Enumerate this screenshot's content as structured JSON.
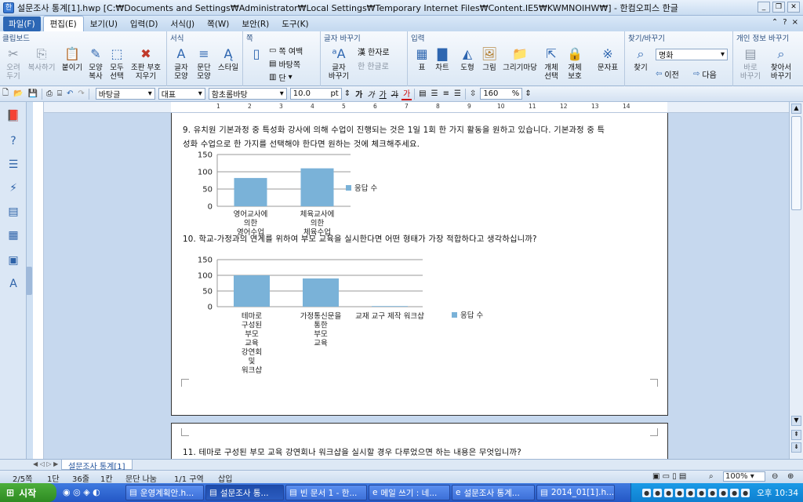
{
  "window": {
    "title": "설문조사 통계[1].hwp [C:₩Documents and Settings₩Administrator₩Local Settings₩Temporary Internet Files₩Content.IE5₩KWMNOIHW₩] - 한컴오피스 한글"
  },
  "menubar": {
    "file": "파일(F)",
    "items": [
      "편집(E)",
      "보기(U)",
      "입력(D)",
      "서식(J)",
      "쪽(W)",
      "보안(R)",
      "도구(K)"
    ],
    "right_help": "?",
    "right_close": "×"
  },
  "ribbon": {
    "groups": [
      {
        "title": "클립보드"
      },
      {
        "title": "서식"
      },
      {
        "title": "쪽"
      },
      {
        "title": "글자 바꾸기"
      },
      {
        "title": "입력"
      },
      {
        "title": "찾기/바꾸기"
      },
      {
        "title": "개인 정보 바꾸기"
      }
    ],
    "buttons": {
      "cut": "오려\n두기",
      "copy": "복사하기",
      "paste": "붙이기",
      "format_copy": "모양\n복사",
      "select_all": "모두\n선택",
      "erase_mark": "조판 부호\n지우기",
      "char_shape": "글자\n모양",
      "para_shape": "문단\n모양",
      "style": "스타일",
      "page_margin": "쪽 여백",
      "background": "바탕쪽",
      "column": "단",
      "char_convert": "글자\n바꾸기",
      "to_hanja": "한자로",
      "to_hangul": "한글로",
      "table": "표",
      "chart": "차트",
      "shape": "도형",
      "picture": "그림",
      "drawing": "그리기마당",
      "object_select": "개체\n선택",
      "object_protect": "개체\n보호",
      "symbol": "문자표",
      "find": "찾기",
      "find_value": "명화",
      "prev": "이전",
      "next": "다음",
      "fix_personal": "바로\n바꾸기",
      "find_personal": "찾아서\n바꾸기"
    }
  },
  "toolbar": {
    "style": "바탕글",
    "font_lang": "대표",
    "font": "함초롬바탕",
    "size": "10.0",
    "size_unit": "pt",
    "bold": "가",
    "italic": "가",
    "underline": "가",
    "strike": "가",
    "color": "가",
    "zoom": "160",
    "zoom_unit": "%"
  },
  "document": {
    "q9_line1": "9. 유치원 기본과정 중 특성화 강사에 의해 수업이 진행되는 것은 1일 1회 한 가지 활동을 원하고 있습니다. 기본과정 중 특",
    "q9_line2": "성화 수업으로 한 가지를 선택해야 한다면 원하는 것에 체크해주세요.",
    "q10": "10. 학교-가정과의 연계를 위하여 부모 교육을 실시한다면 어떤 형태가 가장 적합하다고 생각하십니까?",
    "q11": "11. 테마로 구성된 부모 교육 강연회나 워크샵을 실시할 경우 다루었으면 하는 내용은 무엇입니까?"
  },
  "chart_data": [
    {
      "type": "bar",
      "categories": [
        "영어교사에\n의한\n영어수업",
        "체육교사에\n의한\n체육수업"
      ],
      "series": [
        {
          "name": "응답 수",
          "values": [
            82,
            110
          ]
        }
      ],
      "yticks": [
        "150",
        "100",
        "50",
        "0"
      ],
      "ylim": [
        0,
        150
      ],
      "legend": "right",
      "color": "#7ab2d8"
    },
    {
      "type": "bar",
      "categories": [
        "테마로\n구성된\n부모\n교육\n강연회\n및\n워크샵",
        "가정통신문을\n통한\n부모\n교육",
        "교재 교구 제작 워크샵"
      ],
      "series": [
        {
          "name": "응답 수",
          "values": [
            100,
            90,
            2
          ]
        }
      ],
      "yticks": [
        "150",
        "100",
        "50",
        "0"
      ],
      "ylim": [
        0,
        150
      ],
      "legend": "right",
      "color": "#7ab2d8"
    }
  ],
  "tabs": {
    "doc_tab": "설문조사 통계[1]"
  },
  "statusbar": {
    "page": "2/5쪽",
    "section": "1단",
    "line": "36줄",
    "col": "1칸",
    "break": "문단 나눔",
    "area": "1/1 구역",
    "mode": "삽입",
    "zoom": "100%"
  },
  "taskbar": {
    "start": "시작",
    "tasks": [
      "운영계획안.h...",
      "설문조사 통...",
      "빈 문서 1 - 한...",
      "메일 쓰기 : 네...",
      "설문조사 통계...",
      "2014_01[1].h..."
    ],
    "clock": "오후 10:34"
  }
}
